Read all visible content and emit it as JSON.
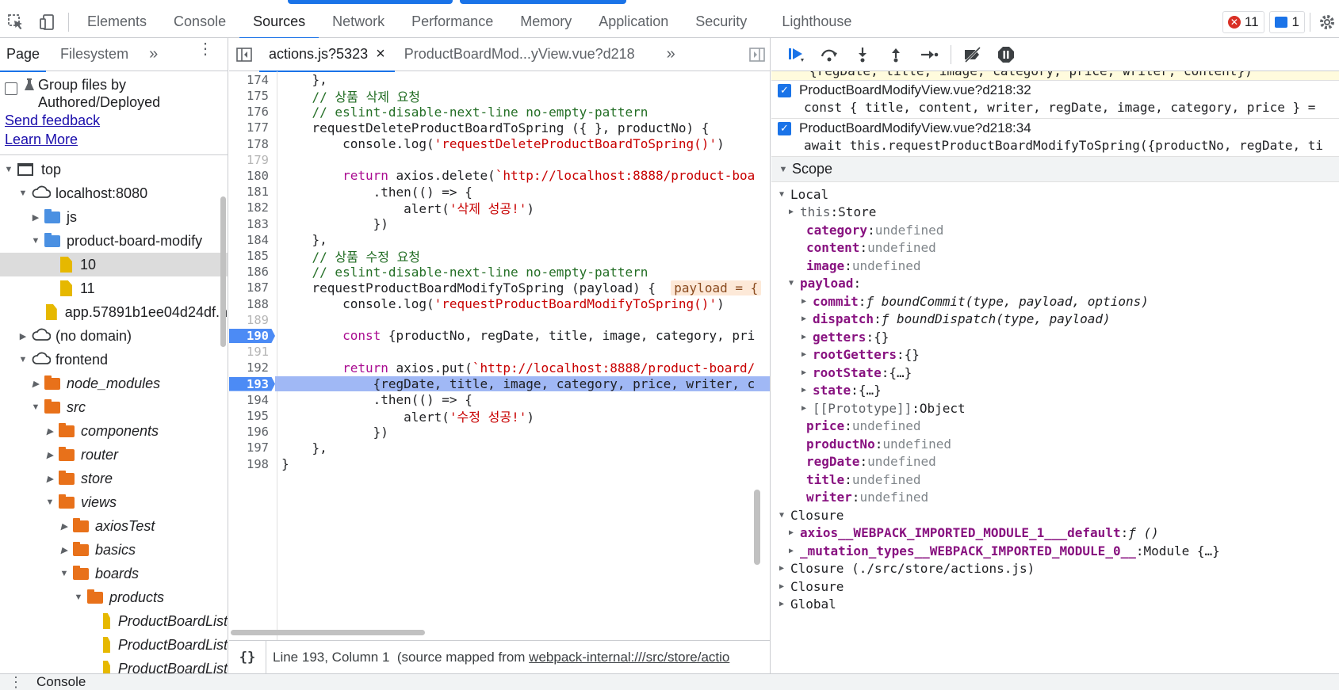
{
  "toolbar": {
    "tabs": [
      "Elements",
      "Console",
      "Sources",
      "Network",
      "Performance",
      "Memory",
      "Application",
      "Security",
      "Lighthouse"
    ],
    "active_tab": "Sources",
    "error_count": "11",
    "message_count": "1"
  },
  "navigator": {
    "tabs": [
      "Page",
      "Filesystem"
    ],
    "more": "»",
    "group_label_line1": "Group files by",
    "group_label_line2": "Authored/Deployed",
    "send_feedback": "Send feedback",
    "learn_more": "Learn More",
    "tree": [
      {
        "label": "top"
      },
      {
        "label": "localhost:8080"
      },
      {
        "label": "js"
      },
      {
        "label": "product-board-modify"
      },
      {
        "label": "10"
      },
      {
        "label": "11"
      },
      {
        "label": "app.57891b1ee04d24df.h"
      },
      {
        "label": "(no domain)"
      },
      {
        "label": "frontend"
      },
      {
        "label": "node_modules"
      },
      {
        "label": "src"
      },
      {
        "label": "components"
      },
      {
        "label": "router"
      },
      {
        "label": "store"
      },
      {
        "label": "views"
      },
      {
        "label": "axiosTest"
      },
      {
        "label": "basics"
      },
      {
        "label": "boards"
      },
      {
        "label": "products"
      },
      {
        "label": "ProductBoardList"
      },
      {
        "label": "ProductBoardList"
      },
      {
        "label": "ProductBoardList"
      }
    ]
  },
  "editor": {
    "tabs": [
      "actions.js?5323",
      "ProductBoardMod...yView.vue?d218"
    ],
    "close": "×",
    "more": "»",
    "status": "Line 193, Column 1  (source mapped from ",
    "status_link": "webpack-internal:///src/store/actio",
    "format_icon": "{}",
    "lines": [
      {
        "n": "174",
        "t": "    },"
      },
      {
        "n": "175",
        "t": "    // 상품 삭제 요청"
      },
      {
        "n": "176",
        "t": "    // eslint-disable-next-line no-empty-pattern"
      },
      {
        "n": "177",
        "t": "    requestDeleteProductBoardToSpring ({ }, productNo) {"
      },
      {
        "n": "178",
        "t": "        console.log('requestDeleteProductBoardToSpring()')"
      },
      {
        "n": "179",
        "t": ""
      },
      {
        "n": "180",
        "t": "        return axios.delete(`http://localhost:8888/product-boa"
      },
      {
        "n": "181",
        "t": "            .then(() => {"
      },
      {
        "n": "182",
        "t": "                alert('삭제 성공!')"
      },
      {
        "n": "183",
        "t": "            })"
      },
      {
        "n": "184",
        "t": "    },"
      },
      {
        "n": "185",
        "t": "    // 상품 수정 요청"
      },
      {
        "n": "186",
        "t": "    // eslint-disable-next-line no-empty-pattern"
      },
      {
        "n": "187",
        "t": "    requestProductBoardModifyToSpring (payload) {  "
      },
      {
        "n": "188",
        "t": "        console.log('requestProductBoardModifyToSpring()')"
      },
      {
        "n": "189",
        "t": ""
      },
      {
        "n": "190",
        "t": "        const {productNo, regDate, title, image, category, pri"
      },
      {
        "n": "191",
        "t": ""
      },
      {
        "n": "192",
        "t": "        return axios.put(`http://localhost:8888/product-board/"
      },
      {
        "n": "193",
        "t": "            {regDate, title, image, category, price, writer, c"
      },
      {
        "n": "194",
        "t": "            .then(() => {"
      },
      {
        "n": "195",
        "t": "                alert('수정 성공!')"
      },
      {
        "n": "196",
        "t": "            })"
      },
      {
        "n": "197",
        "t": "    },"
      },
      {
        "n": "198",
        "t": "}"
      }
    ],
    "inline_value": "payload = {"
  },
  "debugger": {
    "paused_line": "{regDate, title, image, category, price, writer, content})",
    "breakpoints": [
      {
        "file": "ProductBoardModifyView.vue?d218:32",
        "code": "const { title, content, writer, regDate, image, category, price } ="
      },
      {
        "file": "ProductBoardModifyView.vue?d218:34",
        "code": "await this.requestProductBoardModifyToSpring({productNo, regDate, ti"
      }
    ],
    "scope_title": "Scope",
    "local_title": "Local",
    "this_label": "this",
    "this_value": "Store",
    "local_vars_a": [
      {
        "k": "category",
        "v": "undefined"
      },
      {
        "k": "content",
        "v": "undefined"
      },
      {
        "k": "image",
        "v": "undefined"
      }
    ],
    "payload_label": "payload",
    "payload_items": [
      {
        "k": "commit",
        "v": "ƒ boundCommit(type, payload, options)"
      },
      {
        "k": "dispatch",
        "v": "ƒ boundDispatch(type, payload)"
      },
      {
        "k": "getters",
        "v": "{}"
      },
      {
        "k": "rootGetters",
        "v": "{}"
      },
      {
        "k": "rootState",
        "v": "{…}"
      },
      {
        "k": "state",
        "v": "{…}"
      },
      {
        "k": "[[Prototype]]",
        "v": "Object"
      }
    ],
    "local_vars_b": [
      {
        "k": "price",
        "v": "undefined"
      },
      {
        "k": "productNo",
        "v": "undefined"
      },
      {
        "k": "regDate",
        "v": "undefined"
      },
      {
        "k": "title",
        "v": "undefined"
      },
      {
        "k": "writer",
        "v": "undefined"
      }
    ],
    "closure_title": "Closure",
    "closure_items": [
      {
        "k": "axios__WEBPACK_IMPORTED_MODULE_1___default",
        "v": "ƒ ()"
      },
      {
        "k": "_mutation_types__WEBPACK_IMPORTED_MODULE_0__",
        "v": "Module {…}"
      }
    ],
    "closure2": "Closure (./src/store/actions.js)",
    "closure3": "Closure",
    "global": "Global"
  },
  "drawer": {
    "label": "Console"
  }
}
